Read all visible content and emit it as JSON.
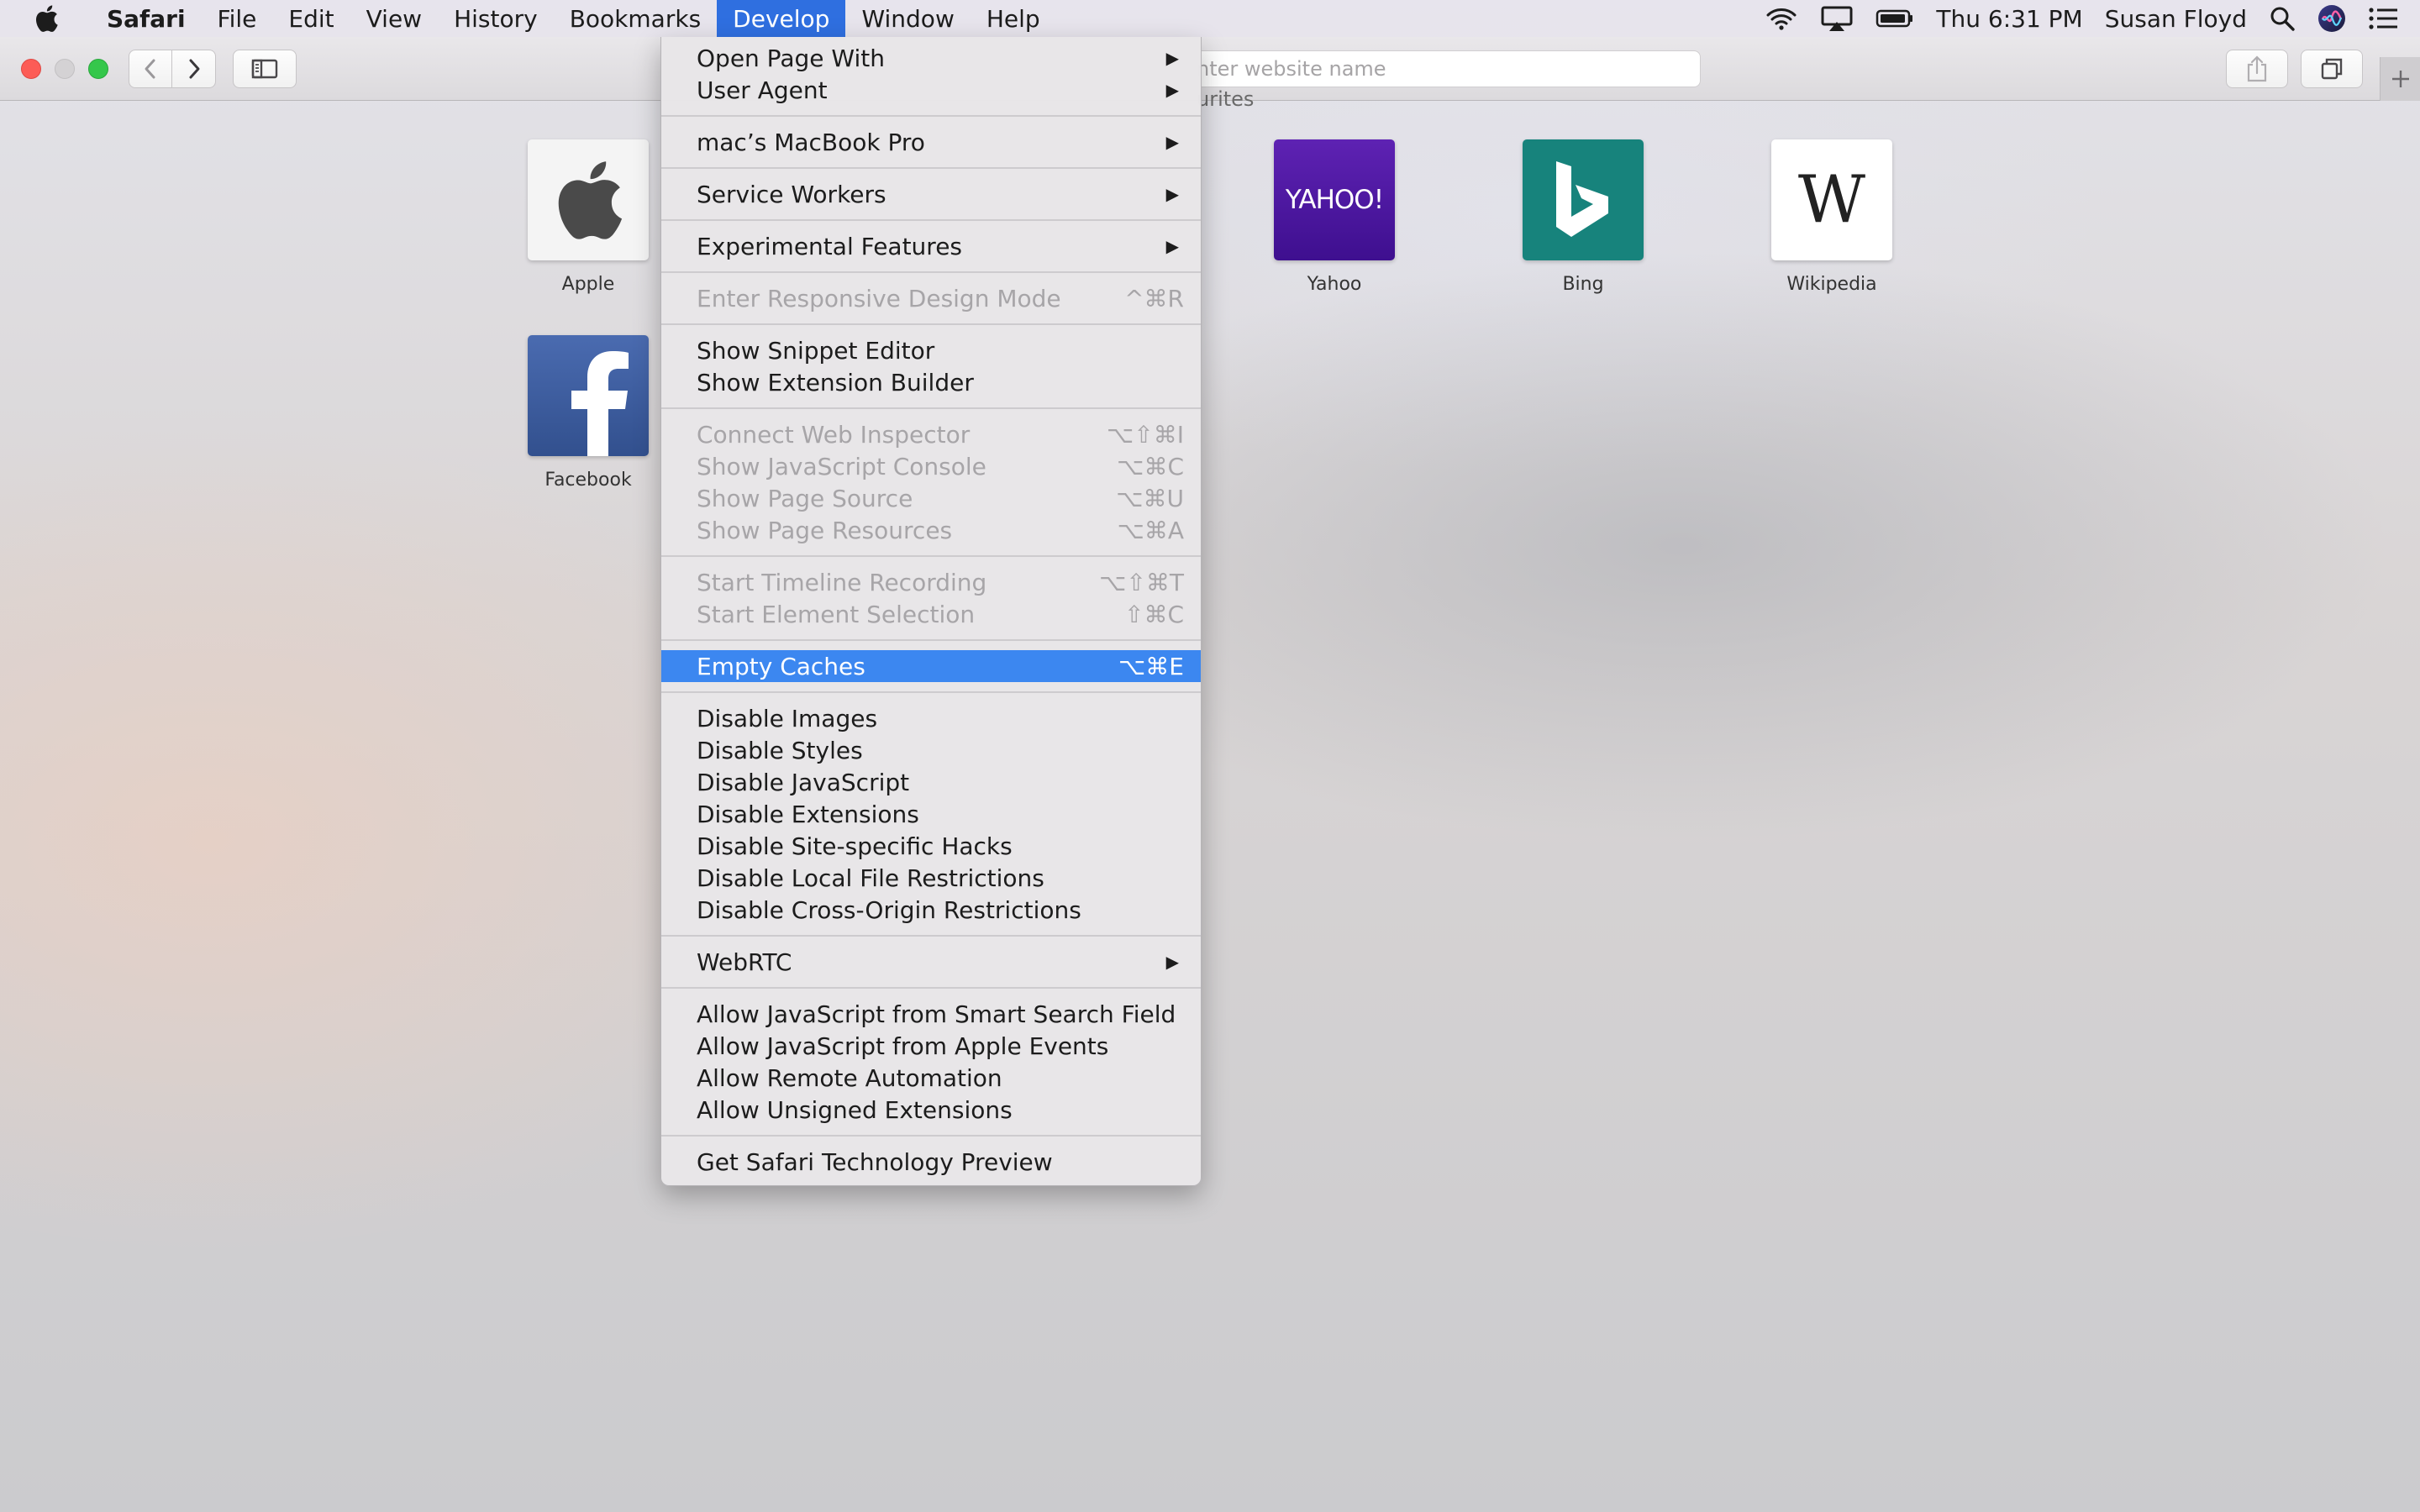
{
  "menubar": {
    "apple_icon": "apple-logo-icon",
    "app_name": "Safari",
    "menus": [
      "File",
      "Edit",
      "View",
      "History",
      "Bookmarks",
      "Develop",
      "Window",
      "Help"
    ],
    "active_menu": "Develop",
    "status_icons": [
      "wifi-icon",
      "airplay-icon",
      "battery-icon"
    ],
    "clock": "Thu 6:31 PM",
    "user": "Susan Floyd",
    "right_icons": [
      "spotlight-search-icon",
      "siri-icon",
      "notification-center-icon"
    ]
  },
  "toolbar": {
    "address_placeholder": "nter website name",
    "icons": [
      "back-icon",
      "forward-icon",
      "sidebar-icon",
      "share-icon",
      "tabs-overview-icon",
      "new-tab-icon"
    ]
  },
  "favorites": {
    "title": "urites",
    "items": [
      {
        "label": "Apple",
        "icon": "apple-logo-icon"
      },
      {
        "label": "Yahoo",
        "tile_text": "YAHOO!"
      },
      {
        "label": "Bing",
        "icon": "bing-logo-icon"
      },
      {
        "label": "Wikipedia",
        "tile_text": "W"
      },
      {
        "label": "Facebook",
        "icon": "facebook-logo-icon"
      }
    ]
  },
  "develop_menu": {
    "open_page_with": {
      "label": "Open Page With",
      "submenu": true
    },
    "user_agent": {
      "label": "User Agent",
      "submenu": true
    },
    "device": {
      "label": "mac’s MacBook Pro",
      "submenu": true
    },
    "service_workers": {
      "label": "Service Workers",
      "submenu": true
    },
    "experimental_features": {
      "label": "Experimental Features",
      "submenu": true
    },
    "responsive_design": {
      "label": "Enter Responsive Design Mode",
      "shortcut": "^⌘R",
      "enabled": false
    },
    "snippet_editor": {
      "label": "Show Snippet Editor"
    },
    "extension_builder": {
      "label": "Show Extension Builder"
    },
    "connect_inspector": {
      "label": "Connect Web Inspector",
      "shortcut": "⌥⇧⌘I",
      "enabled": false
    },
    "js_console": {
      "label": "Show JavaScript Console",
      "shortcut": "⌥⌘C",
      "enabled": false
    },
    "page_source": {
      "label": "Show Page Source",
      "shortcut": "⌥⌘U",
      "enabled": false
    },
    "page_resources": {
      "label": "Show Page Resources",
      "shortcut": "⌥⌘A",
      "enabled": false
    },
    "timeline_recording": {
      "label": "Start Timeline Recording",
      "shortcut": "⌥⇧⌘T",
      "enabled": false
    },
    "element_selection": {
      "label": "Start Element Selection",
      "shortcut": "⇧⌘C",
      "enabled": false
    },
    "empty_caches": {
      "label": "Empty Caches",
      "shortcut": "⌥⌘E",
      "highlighted": true
    },
    "disable_images": {
      "label": "Disable Images"
    },
    "disable_styles": {
      "label": "Disable Styles"
    },
    "disable_javascript": {
      "label": "Disable JavaScript"
    },
    "disable_extensions": {
      "label": "Disable Extensions"
    },
    "disable_site_hacks": {
      "label": "Disable Site-specific Hacks"
    },
    "disable_local_file": {
      "label": "Disable Local File Restrictions"
    },
    "disable_cross_origin": {
      "label": "Disable Cross-Origin Restrictions"
    },
    "webrtc": {
      "label": "WebRTC",
      "submenu": true
    },
    "allow_js_smart_search": {
      "label": "Allow JavaScript from Smart Search Field"
    },
    "allow_js_apple_events": {
      "label": "Allow JavaScript from Apple Events"
    },
    "allow_remote_automation": {
      "label": "Allow Remote Automation"
    },
    "allow_unsigned_extensions": {
      "label": "Allow Unsigned Extensions"
    },
    "technology_preview": {
      "label": "Get Safari Technology Preview"
    }
  },
  "colors": {
    "menu_highlight": "#3c87f0",
    "active_menu_title": "#2f6fe0",
    "disabled_text": "#a7a5a8"
  }
}
